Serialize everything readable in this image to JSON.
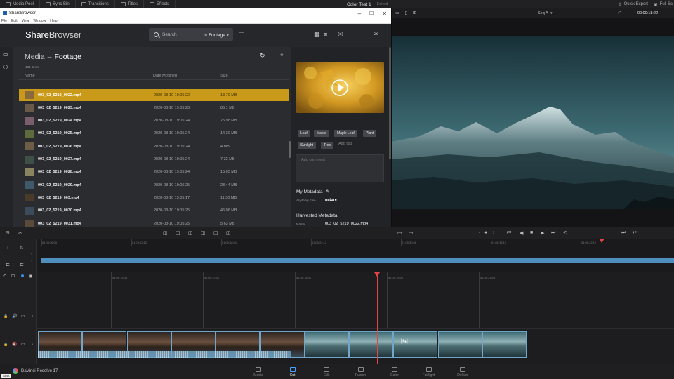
{
  "resolve": {
    "top_tabs": [
      {
        "label": "Media Pool",
        "icon": "media-pool-icon"
      },
      {
        "label": "Sync Bin",
        "icon": "sync-bin-icon"
      },
      {
        "label": "Transitions",
        "icon": "transitions-icon"
      },
      {
        "label": "Titles",
        "icon": "titles-icon"
      },
      {
        "label": "Effects",
        "icon": "effects-icon"
      }
    ],
    "project_title": "Color Test 1",
    "project_status": "Edited",
    "quick_export": "Quick Export",
    "full_screen": "Full Sc",
    "viewer_seq": "Seq A",
    "viewer_timecode": "00:00:18:22",
    "app_name": "DaVinci Resolve 17",
    "start_label": "Start",
    "pages": [
      "Media",
      "Cut",
      "Edit",
      "Fusion",
      "Color",
      "Fairlight",
      "Deliver"
    ],
    "active_page": "Cut",
    "upper_ruler": [
      "01:00:06:00",
      "01:00:12:12",
      "01:00:18:01",
      "01:00:24:12",
      "01:00:30:06",
      "01:00:36:12",
      "01:00:42:12"
    ],
    "lower_ruler": [
      "01:00:15:08",
      "01:00:12:01",
      "01:00:18:01",
      "01:00:15:00",
      "01:00:21:08"
    ],
    "track_numbers": [
      "2",
      "1"
    ],
    "accent": "#c99a19"
  },
  "sharebrowser": {
    "window_title": "ShareBrowser",
    "menu": [
      "File",
      "Edit",
      "View",
      "Window",
      "Help"
    ],
    "logo_share": "Share",
    "logo_browser": "Browser",
    "search_placeholder": "Search",
    "search_in": "in",
    "search_scope": "Footage",
    "crumb_parent": "Media",
    "crumb_sep": "–",
    "crumb_current": "Footage",
    "item_count": "134 items",
    "columns": {
      "name": "Name",
      "date": "Date Modified",
      "size": "Size"
    },
    "rows": [
      {
        "name": "003_02_5219_0022.mp4",
        "date": "2020-08-10 19:05:22",
        "size": "13.79 MB"
      },
      {
        "name": "003_02_5219_0023.mp4",
        "date": "2020-08-10 19:05:23",
        "size": "85.1 MB"
      },
      {
        "name": "003_02_5219_0024.mp4",
        "date": "2020-08-10 19:05:24",
        "size": "26.98 MB"
      },
      {
        "name": "003_02_5219_0025.mp4",
        "date": "2020-08-10 19:05:24",
        "size": "14.30 MB"
      },
      {
        "name": "003_02_5219_0026.mp4",
        "date": "2020-08-10 19:05:24",
        "size": "4 MB"
      },
      {
        "name": "003_02_5219_0027.mp4",
        "date": "2020-08-10 19:05:24",
        "size": "7.32 MB"
      },
      {
        "name": "003_02_5219_0028.mp4",
        "date": "2020-08-10 19:05:24",
        "size": "15.05 MB"
      },
      {
        "name": "003_02_5219_0029.mp4",
        "date": "2020-08-10 19:05:25",
        "size": "23.44 MB"
      },
      {
        "name": "003_02_5219_003.mp4",
        "date": "2020-08-10 19:05:17",
        "size": "11.30 MB"
      },
      {
        "name": "003_02_5219_0030.mp4",
        "date": "2020-08-10 19:05:25",
        "size": "46.06 MB"
      },
      {
        "name": "003_02_5219_0031.mp4",
        "date": "2020-08-10 19:05:25",
        "size": "5.63 MB"
      }
    ],
    "selected_index": 0,
    "tags": [
      "Leaf",
      "Maple",
      "Maple Leaf",
      "Plant",
      "Sunlight",
      "Tree"
    ],
    "add_tag": "Add tag",
    "comment_placeholder": "Add comment",
    "my_metadata": "My Metadata",
    "anything_else_label": "Anything Else",
    "anything_else_value": "nature",
    "harvested_metadata": "Harvested Metadata",
    "name_label": "Name",
    "name_value": "003_02_5219_0022.mp4"
  }
}
